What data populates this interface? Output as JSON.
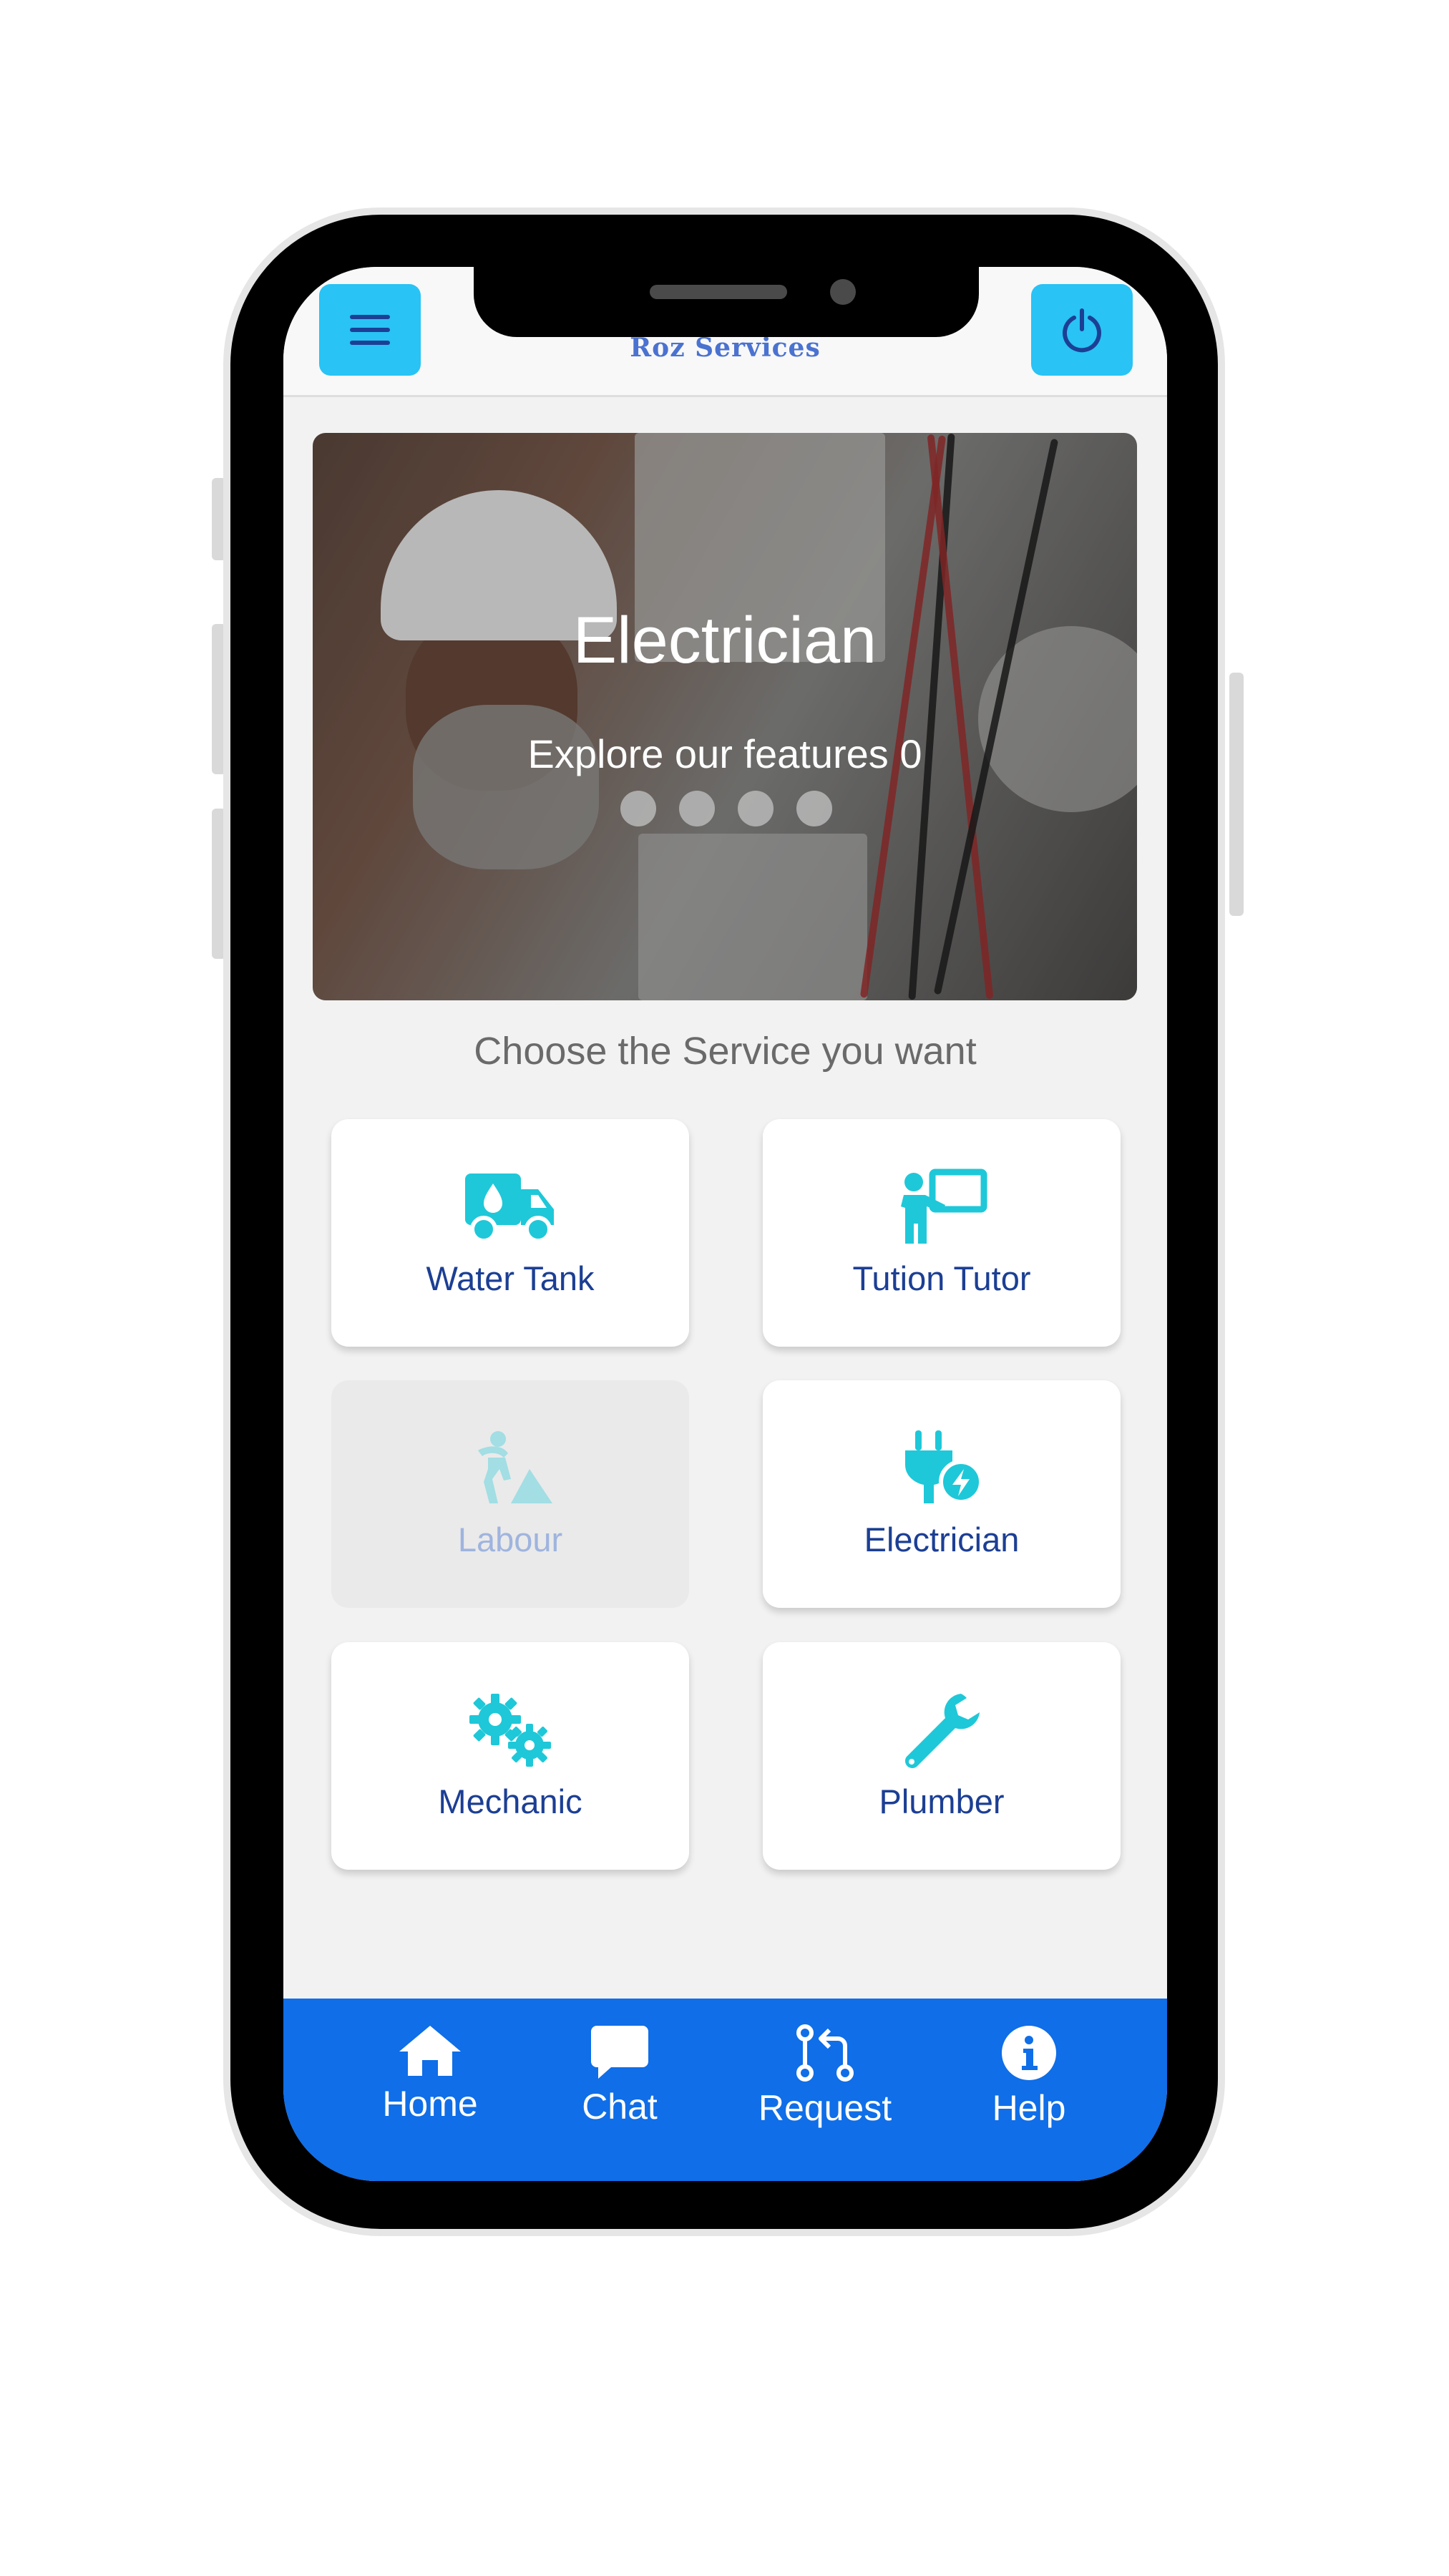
{
  "app": {
    "logo_text": "Roz Services"
  },
  "header": {
    "menu_icon": "hamburger-menu-icon",
    "power_icon": "power-icon"
  },
  "banner": {
    "title": "Electrician",
    "subtitle": "Explore our features  0",
    "slide_count": 4
  },
  "services": {
    "heading": "Choose the Service you want",
    "items": [
      {
        "label": "Water Tank",
        "icon": "water-truck-icon",
        "enabled": true
      },
      {
        "label": "Tution Tutor",
        "icon": "tutor-board-icon",
        "enabled": true
      },
      {
        "label": "Labour",
        "icon": "labour-worker-icon",
        "enabled": false
      },
      {
        "label": "Electrician",
        "icon": "plug-bolt-icon",
        "enabled": true
      },
      {
        "label": "Mechanic",
        "icon": "gears-icon",
        "enabled": true
      },
      {
        "label": "Plumber",
        "icon": "wrench-icon",
        "enabled": true
      }
    ]
  },
  "bottom_nav": {
    "items": [
      {
        "label": "Home",
        "icon": "home-icon"
      },
      {
        "label": "Chat",
        "icon": "chat-bubble-icon"
      },
      {
        "label": "Request",
        "icon": "request-swap-icon"
      },
      {
        "label": "Help",
        "icon": "info-icon"
      }
    ]
  },
  "colors": {
    "accent_cyan": "#29c3f5",
    "icon_teal": "#1ec8d8",
    "nav_blue": "#0f6ee8",
    "label_navy": "#1c3f94"
  }
}
